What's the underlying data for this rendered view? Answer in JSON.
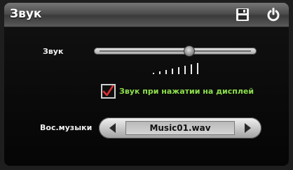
{
  "header": {
    "title": "Звук",
    "save_icon": "floppy-disk-icon",
    "power_icon": "power-icon"
  },
  "volume": {
    "label": "Звук",
    "level": 0.58,
    "bars": 8
  },
  "touch_sound": {
    "label": "Звук при нажатии на дисплей",
    "checked": true,
    "check_color": "#e03030"
  },
  "music": {
    "label": "Вос.музыки",
    "value": "Music01.wav",
    "prev_icon": "arrow-left-icon",
    "next_icon": "arrow-right-icon"
  },
  "colors": {
    "accent_green": "#8de04a",
    "check_red": "#e03030"
  }
}
